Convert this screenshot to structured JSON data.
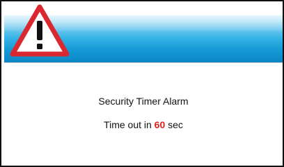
{
  "dialog": {
    "icon": "warning-triangle-icon",
    "title": "Security Timer Alarm",
    "countdown": {
      "prefix": "Time out in",
      "value": "60",
      "suffix": "sec"
    }
  },
  "colors": {
    "header_blue": "#1498d6",
    "warning_red": "#d9282f",
    "countdown_red": "#e0201c"
  }
}
